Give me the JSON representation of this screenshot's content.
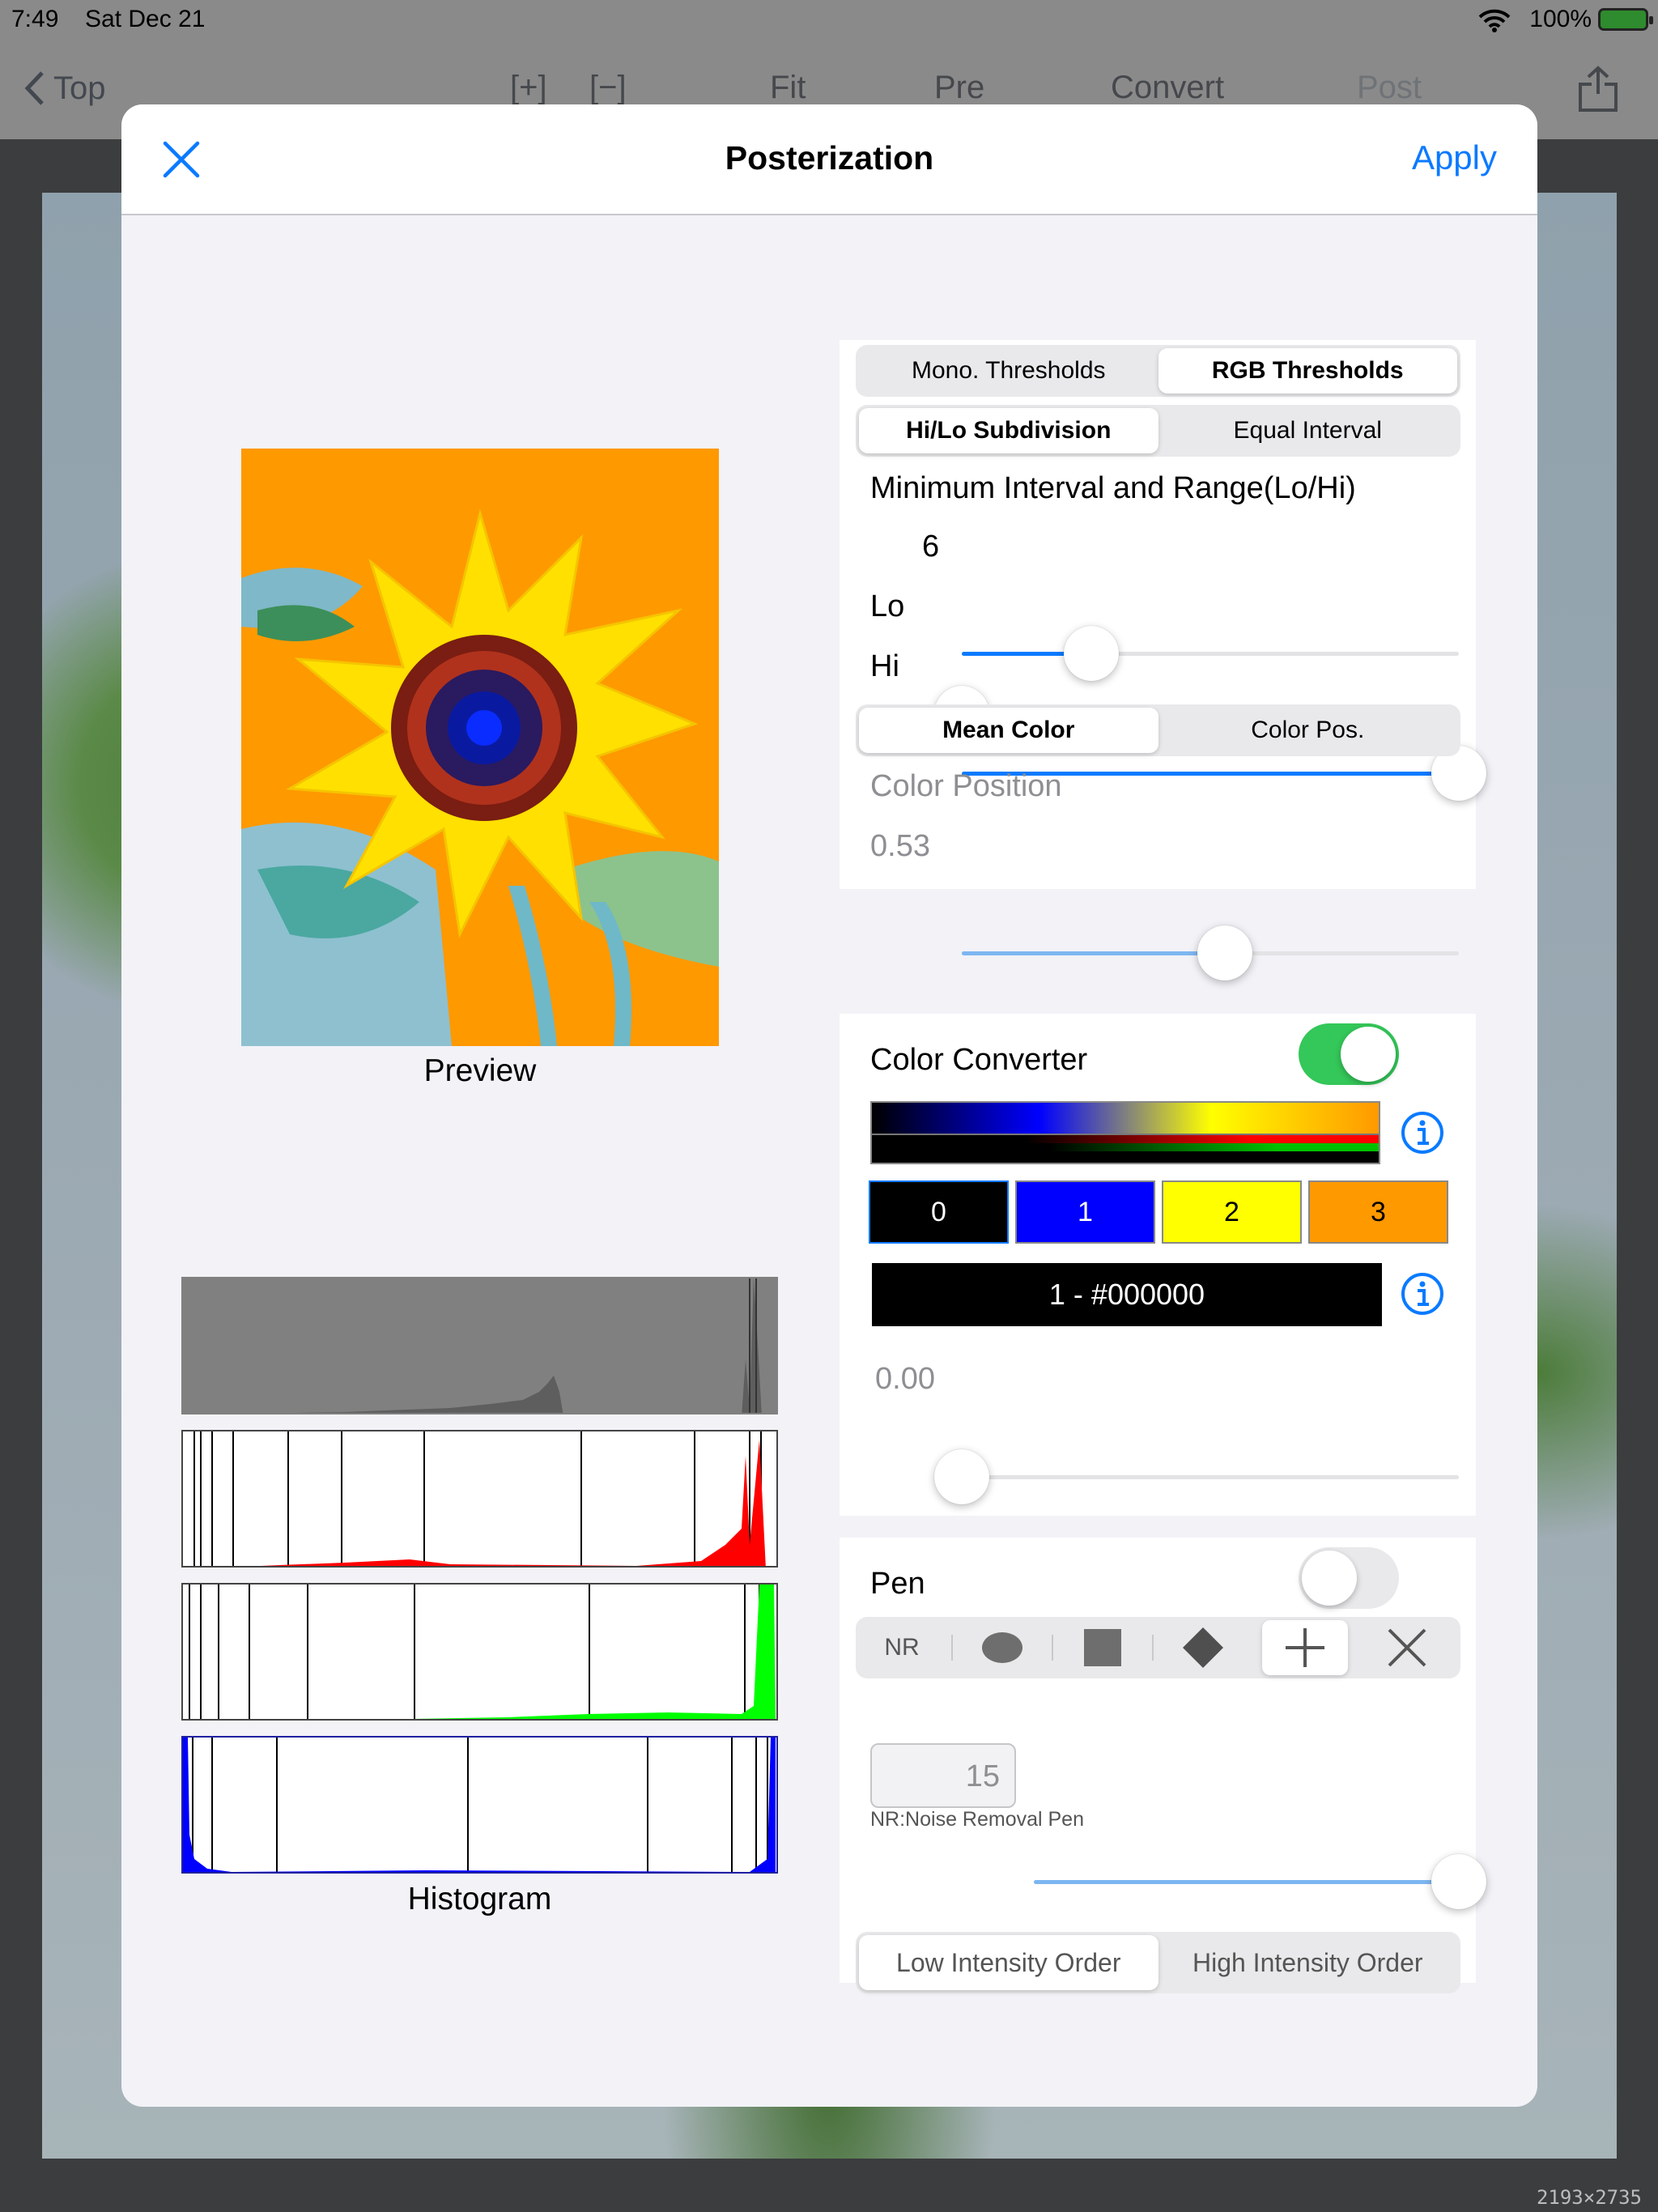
{
  "status_bar": {
    "time": "7:49",
    "date": "Sat Dec 21",
    "battery": "100%"
  },
  "nav": {
    "back_label": "Top",
    "items": [
      "[+]",
      "[−]",
      "Fit",
      "Pre",
      "Convert",
      "Post"
    ]
  },
  "image_dimensions": "2193×2735",
  "modal": {
    "title": "Posterization",
    "apply": "Apply"
  },
  "preview": {
    "caption": "Preview"
  },
  "histogram": {
    "caption": "Histogram"
  },
  "threshold_panel": {
    "threshold_modes": [
      "Mono. Thresholds",
      "RGB Thresholds"
    ],
    "threshold_selected": "RGB Thresholds",
    "division_modes": [
      "Hi/Lo Subdivision",
      "Equal Interval"
    ],
    "division_selected": "Hi/Lo Subdivision",
    "range_label": "Minimum Interval and Range(Lo/Hi)",
    "interval_value": "6",
    "interval_fraction": 0.26,
    "lo_label": "Lo",
    "lo_fraction": 0.0,
    "hi_label": "Hi",
    "hi_fraction": 1.0,
    "color_modes": [
      "Mean Color",
      "Color Pos."
    ],
    "color_selected": "Mean Color",
    "color_position_label": "Color Position",
    "color_position_value": "0.53",
    "color_position_fraction": 0.53
  },
  "converter_panel": {
    "label": "Color Converter",
    "enabled": true,
    "swatches": [
      {
        "label": "0",
        "color": "#000000",
        "text_color": "#ffffff"
      },
      {
        "label": "1",
        "color": "#0000ff",
        "text_color": "#ffffff"
      },
      {
        "label": "2",
        "color": "#ffff00",
        "text_color": "#000000"
      },
      {
        "label": "3",
        "color": "#ff9900",
        "text_color": "#000000"
      }
    ],
    "selected_color": "1 - #000000",
    "slider_value": "0.00",
    "slider_fraction": 0.0
  },
  "pen_panel": {
    "label": "Pen",
    "enabled": false,
    "tools": [
      "NR",
      "circle",
      "square",
      "diamond",
      "plus",
      "cross"
    ],
    "selected_tool": "plus",
    "note": "NR:Noise Removal Pen",
    "size_value": "15",
    "size_fraction": 1.0,
    "order_modes": [
      "Low Intensity Order",
      "High Intensity Order"
    ],
    "order_selected": "Low Intensity Order"
  },
  "colors": {
    "accent": "#0a7aff",
    "toggle_on": "#34c759",
    "toggle_off": "#e9e9eb"
  }
}
